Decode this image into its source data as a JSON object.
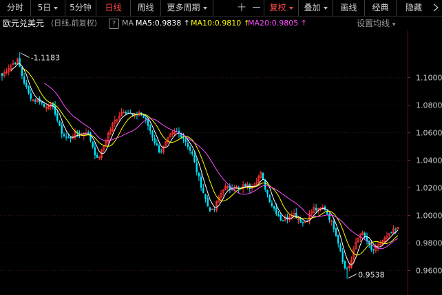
{
  "toolbar": {
    "items": [
      "分时",
      "5日",
      "5分钟",
      "日线",
      "周线",
      "更多周期",
      "十",
      "一",
      "复权",
      "叠加",
      "画线",
      "经典",
      "隐藏"
    ]
  },
  "info": {
    "symbol": "欧元兑美元",
    "mode": "(日线,前复权)",
    "help": "?",
    "ma_label": "MA",
    "ma5": "MA5:0.9838",
    "ma10": "MA10:0.9810",
    "ma20": "MA20:0.9805",
    "settings": "设置均线"
  },
  "colors": {
    "up": "#ff3232",
    "down": "#00e5ff",
    "ma5": "#ffffff",
    "ma10": "#ffff00",
    "ma20": "#ff4cff",
    "active": "#ff4a4a"
  },
  "chart_data": {
    "type": "candlestick",
    "y_ticks": [
      "1.1000",
      "1.0800",
      "1.0600",
      "1.0400",
      "1.0200",
      "1.0000",
      "0.9800",
      "0.9600"
    ],
    "y_tick_values": [
      1.1,
      1.08,
      1.06,
      1.04,
      1.02,
      1.0,
      0.98,
      0.96
    ],
    "ylim": [
      0.951,
      1.126
    ],
    "high_label": "1.1183",
    "high_value": 1.1183,
    "low_label": "0.9538",
    "low_value": 0.9538,
    "close_path": [
      1.101,
      1.106,
      1.11,
      1.112,
      1.098,
      1.088,
      1.083,
      1.084,
      1.078,
      1.081,
      1.075,
      1.062,
      1.056,
      1.056,
      1.06,
      1.058,
      1.061,
      1.052,
      1.04,
      1.047,
      1.058,
      1.066,
      1.072,
      1.076,
      1.074,
      1.071,
      1.075,
      1.07,
      1.062,
      1.052,
      1.045,
      1.052,
      1.058,
      1.06,
      1.058,
      1.052,
      1.044,
      1.03,
      1.018,
      1.006,
      1.002,
      1.012,
      1.02,
      1.019,
      1.021,
      1.018,
      1.022,
      1.02,
      1.024,
      1.03,
      1.018,
      1.008,
      1.002,
      0.996,
      0.998,
      1.002,
      0.998,
      0.994,
      0.998,
      1.005,
      1.003,
      1.006,
      0.998,
      0.99,
      0.976,
      0.96,
      0.964,
      0.98,
      0.988,
      0.982,
      0.974,
      0.976,
      0.981,
      0.984,
      0.988,
      0.99
    ]
  }
}
